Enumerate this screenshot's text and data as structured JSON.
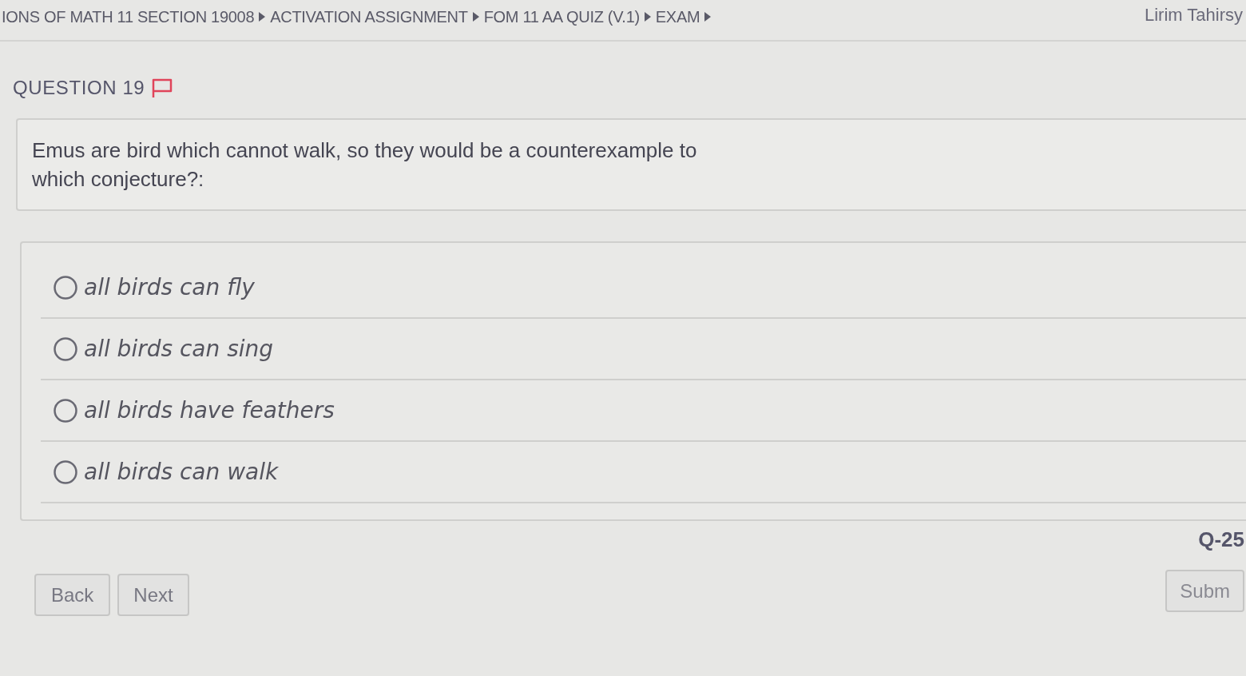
{
  "breadcrumb": [
    "IONS OF MATH 11 SECTION 19008",
    "ACTIVATION ASSIGNMENT",
    "FOM 11 AA QUIZ (V.1)",
    "EXAM"
  ],
  "user": "Lirim Tahirsy",
  "question": {
    "title": "QUESTION 19",
    "text": "Emus are bird which cannot walk, so they would be a counterexample to which conjecture?:"
  },
  "options": [
    {
      "label": "all birds can fly",
      "selected": false
    },
    {
      "label": "all birds can sing",
      "selected": false
    },
    {
      "label": "all birds have feathers",
      "selected": false
    },
    {
      "label": "all birds can walk",
      "selected": false
    }
  ],
  "question_code": "Q-25",
  "buttons": {
    "back": "Back",
    "next": "Next",
    "submit": "Subm"
  }
}
